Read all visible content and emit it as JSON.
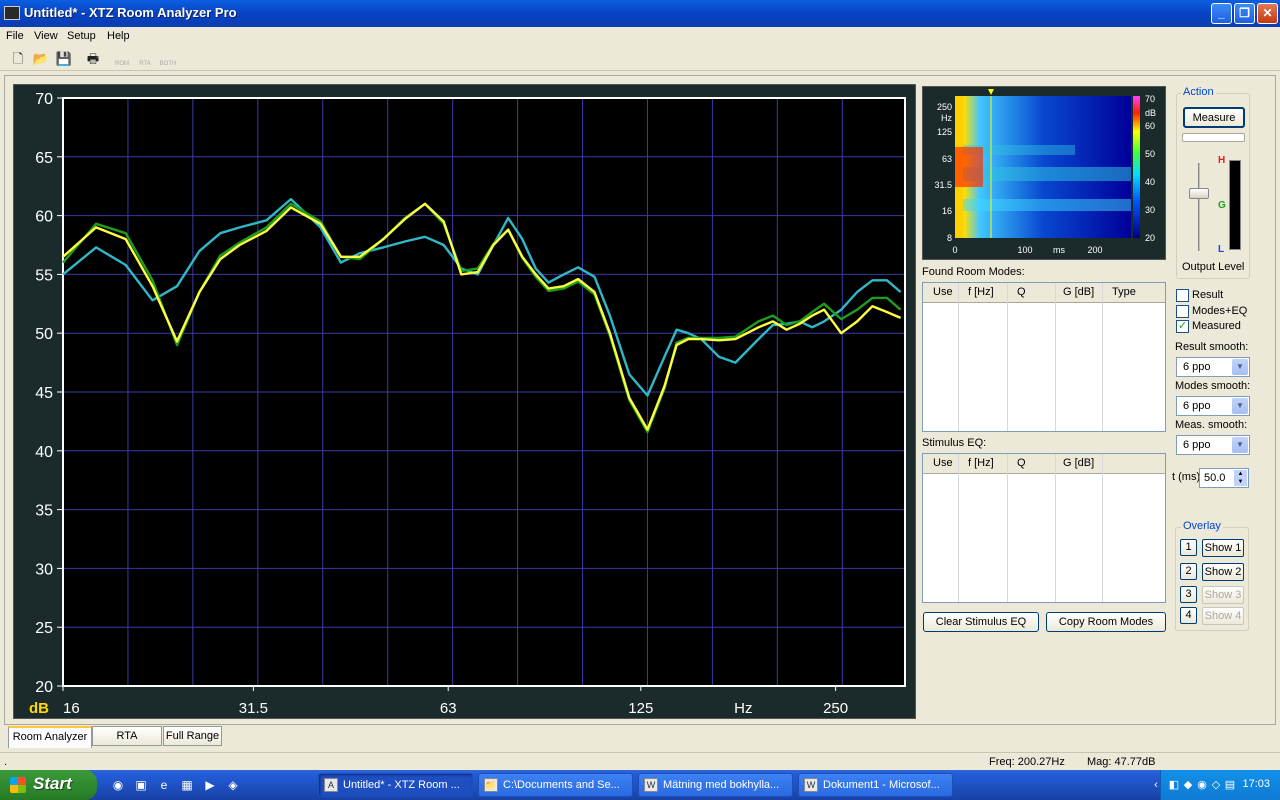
{
  "window": {
    "title": "Untitled* - XTZ Room Analyzer Pro",
    "buttons": {
      "minimize": "_",
      "maximize": "❐",
      "close": "✕"
    }
  },
  "menu": [
    "File",
    "View",
    "Setup",
    "Help"
  ],
  "toolbar": {
    "new": "🗋",
    "open": "📂",
    "save": "💾",
    "print": "🖶",
    "room": "ROM",
    "rta": "RTA",
    "both": "BOTH"
  },
  "plot": {
    "unit_label": "dB",
    "x_unit_label": "Hz",
    "y_ticks": [
      "70",
      "65",
      "60",
      "55",
      "50",
      "45",
      "40",
      "35",
      "30",
      "25",
      "20"
    ],
    "x_ticks": [
      "16",
      "31.5",
      "63",
      "125",
      "250"
    ],
    "colors": {
      "background": "#000000",
      "grid": "#3a3aa8",
      "axis": "#ffffff",
      "labels": "#ffffff",
      "unit": "#ffd800"
    }
  },
  "chart_data": {
    "type": "line",
    "xlabel": "Hz",
    "ylabel": "dB",
    "xscale": "log",
    "xlim": [
      16,
      320
    ],
    "ylim": [
      20,
      70
    ],
    "grid": true,
    "series": [
      {
        "color": "#ffff40",
        "x": [
          16,
          18,
          20,
          22,
          24,
          26,
          28,
          30,
          33,
          36,
          40,
          43,
          46,
          50,
          54,
          58,
          62,
          66,
          70,
          74,
          78,
          82,
          86,
          90,
          95,
          100,
          106,
          112,
          120,
          128,
          136,
          142,
          148,
          155,
          165,
          175,
          190,
          200,
          210,
          220,
          230,
          240,
          255,
          270,
          285,
          300,
          315
        ],
        "y": [
          56.5,
          59.0,
          58.0,
          54.0,
          49.3,
          53.5,
          56.3,
          57.5,
          58.7,
          60.7,
          59.3,
          56.5,
          56.5,
          58.0,
          59.7,
          61.0,
          59.5,
          55.0,
          55.2,
          57.5,
          58.8,
          56.5,
          55.0,
          53.8,
          54.0,
          54.6,
          53.5,
          50.0,
          44.5,
          41.8,
          45.5,
          49.0,
          49.5,
          49.5,
          49.4,
          49.5,
          50.5,
          51.0,
          50.3,
          50.8,
          51.5,
          52.0,
          50.0,
          51.0,
          52.3,
          51.8,
          51.3
        ]
      },
      {
        "color": "#1e9e1e",
        "x": [
          16,
          18,
          20,
          22,
          24,
          26,
          28,
          30,
          33,
          36,
          40,
          43,
          46,
          50,
          54,
          58,
          62,
          66,
          70,
          74,
          78,
          82,
          86,
          90,
          95,
          100,
          106,
          112,
          120,
          128,
          136,
          142,
          148,
          155,
          165,
          175,
          190,
          200,
          210,
          220,
          230,
          240,
          255,
          270,
          285,
          300,
          315
        ],
        "y": [
          56.0,
          59.3,
          58.5,
          54.5,
          49.0,
          53.5,
          56.6,
          57.7,
          59.0,
          61.0,
          59.5,
          56.5,
          56.3,
          58.0,
          59.8,
          61.0,
          59.3,
          55.3,
          55.5,
          57.6,
          58.8,
          56.4,
          54.8,
          53.6,
          53.8,
          54.4,
          53.3,
          49.8,
          44.3,
          41.6,
          45.3,
          49.2,
          49.6,
          49.6,
          49.6,
          49.7,
          51.0,
          51.5,
          50.7,
          51.0,
          51.8,
          52.5,
          51.2,
          52.0,
          53.0,
          53.0,
          52.0
        ]
      },
      {
        "color": "#2fb8c8",
        "x": [
          16,
          18,
          20,
          22,
          24,
          26,
          28,
          30,
          33,
          36,
          40,
          43,
          46,
          50,
          54,
          58,
          62,
          66,
          70,
          74,
          78,
          82,
          86,
          90,
          95,
          100,
          106,
          112,
          120,
          128,
          136,
          142,
          148,
          155,
          165,
          175,
          190,
          200,
          210,
          220,
          230,
          240,
          255,
          270,
          285,
          300,
          315
        ],
        "y": [
          55.0,
          57.3,
          55.8,
          52.8,
          54.0,
          57.0,
          58.5,
          59.0,
          59.6,
          61.4,
          59.0,
          56.0,
          56.8,
          57.3,
          57.8,
          58.2,
          57.5,
          55.5,
          55.0,
          57.5,
          59.8,
          58.0,
          55.5,
          54.3,
          55.0,
          55.6,
          54.8,
          51.5,
          46.5,
          44.7,
          48.0,
          50.3,
          50.0,
          49.5,
          48.0,
          47.5,
          49.5,
          50.7,
          50.8,
          51.0,
          50.5,
          51.0,
          52.0,
          53.5,
          54.5,
          54.5,
          53.5
        ]
      }
    ]
  },
  "spectrogram": {
    "y_ticks": [
      "250",
      "125",
      "63",
      "31.5",
      "16",
      "8"
    ],
    "y_unit": "Hz",
    "x_ticks": [
      "0",
      "100",
      "ms",
      "200"
    ],
    "db_ticks": [
      "70",
      "dB",
      "60",
      "50",
      "40",
      "30",
      "20"
    ]
  },
  "found_room_modes": {
    "label": "Found Room Modes:",
    "columns": [
      "Use",
      "f [Hz]",
      "Q",
      "G [dB]",
      "Type"
    ]
  },
  "stimulus_eq": {
    "label": "Stimulus EQ:",
    "columns": [
      "Use",
      "f [Hz]",
      "Q",
      "G [dB]"
    ]
  },
  "buttons": {
    "clear_eq": "Clear Stimulus EQ",
    "copy_modes": "Copy Room Modes",
    "measure": "Measure"
  },
  "action": {
    "title": "Action",
    "meter_labels": {
      "high": "H",
      "good": "G",
      "low": "L"
    },
    "output_level_label": "Output Level",
    "checkboxes": [
      {
        "label": "Result",
        "checked": ""
      },
      {
        "label": "Modes+EQ",
        "checked": ""
      },
      {
        "label": "Measured",
        "checked": "✓"
      }
    ],
    "result_smooth": {
      "label": "Result smooth:",
      "value": "6 ppo"
    },
    "modes_smooth": {
      "label": "Modes smooth:",
      "value": "6 ppo"
    },
    "meas_smooth": {
      "label": "Meas. smooth:",
      "value": "6 ppo"
    },
    "t_ms": {
      "label": "t (ms)",
      "value": "50.0"
    },
    "dropdown_arrow": "▼",
    "spin_up": "▲",
    "spin_down": "▼"
  },
  "overlay": {
    "title": "Overlay",
    "items": [
      {
        "num": "1",
        "label": "Show 1"
      },
      {
        "num": "2",
        "label": "Show 2"
      },
      {
        "num": "3",
        "label": "Show 3"
      },
      {
        "num": "4",
        "label": "Show 4"
      }
    ]
  },
  "tabs": [
    "Room Analyzer",
    "RTA",
    "Full Range"
  ],
  "status": {
    "left": ".",
    "freq": "Freq: 200.27Hz",
    "mag": "Mag: 47.77dB"
  },
  "taskbar": {
    "start": "Start",
    "items": [
      {
        "label": "Untitled* - XTZ Room ...",
        "icon": "A"
      },
      {
        "label": "C:\\Documents and Se...",
        "icon": "📁"
      },
      {
        "label": "Mätning med bokhylla...",
        "icon": "W"
      },
      {
        "label": "Dokument1 - Microsof...",
        "icon": "W"
      }
    ],
    "quicklaunch": [
      "◉",
      "▣",
      "e",
      "▦",
      "▶",
      "◈"
    ],
    "tray_icons": [
      "‹",
      "◧",
      "◆",
      "◉",
      "◇",
      "▤"
    ],
    "clock": "17:03"
  }
}
